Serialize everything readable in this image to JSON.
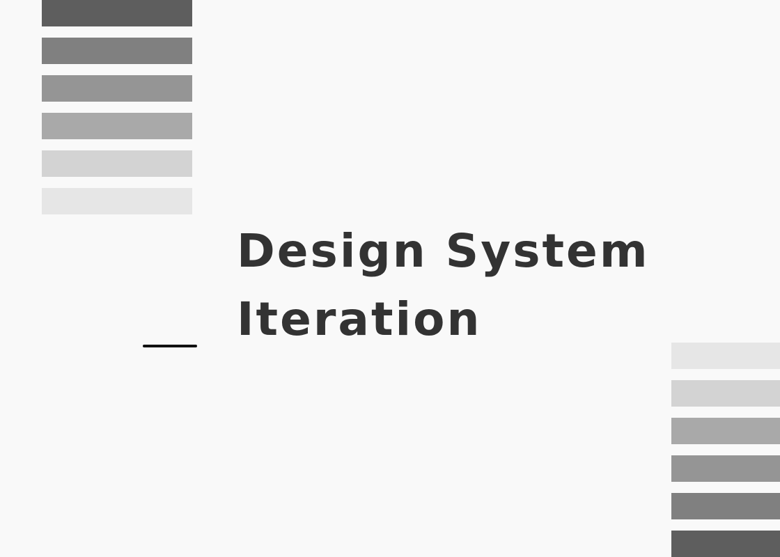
{
  "title": {
    "line1": "Design System",
    "line2": "Iteration"
  },
  "colors": {
    "background": "#f9f9f9",
    "title_text": "#333333",
    "accent_line": "#111111"
  },
  "swatches": {
    "top_left": [
      "#5e5e5e",
      "#808080",
      "#959595",
      "#a9a9a9",
      "#d3d3d3",
      "#e6e6e6"
    ],
    "bottom_right": [
      "#e6e6e6",
      "#d3d3d3",
      "#a9a9a9",
      "#959595",
      "#808080",
      "#5e5e5e"
    ]
  }
}
